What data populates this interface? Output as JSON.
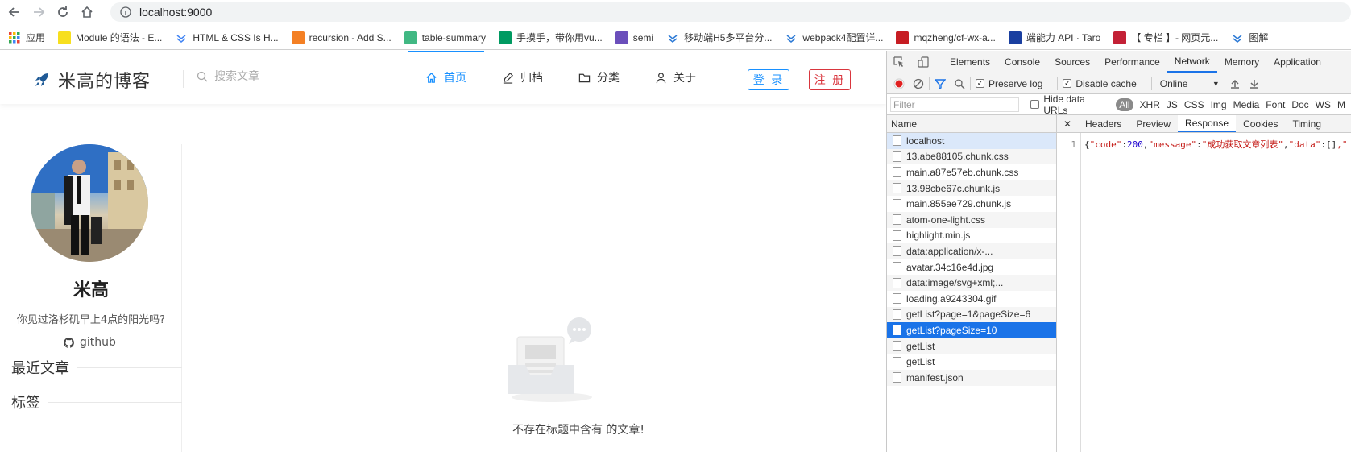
{
  "browser": {
    "url": "localhost:9000",
    "bookmarks": [
      {
        "label": "应用",
        "icon": "apps-grid-icon",
        "color": "#1a73e8"
      },
      {
        "label": "Module 的语法 - E...",
        "icon": "es-icon",
        "color": "#f7df1e"
      },
      {
        "label": "HTML & CSS Is H...",
        "icon": "star-icon",
        "color": "#4285f4"
      },
      {
        "label": "recursion - Add S...",
        "icon": "stackoverflow-icon",
        "color": "#f48024"
      },
      {
        "label": "table-summary",
        "icon": "vue-icon",
        "color": "#41b883"
      },
      {
        "label": "手摸手，带你用vu...",
        "icon": "sf-icon",
        "color": "#009a61"
      },
      {
        "label": "semi",
        "icon": "semi-icon",
        "color": "#6b4fbb"
      },
      {
        "label": "移动端H5多平台分...",
        "icon": "chevrons-icon",
        "color": "#2e7bd6"
      },
      {
        "label": "webpack4配置详...",
        "icon": "chevrons-icon",
        "color": "#2e7bd6"
      },
      {
        "label": "mqzheng/cf-wx-a...",
        "icon": "gitee-icon",
        "color": "#c71d23"
      },
      {
        "label": "端能力 API · Taro",
        "icon": "taro-icon",
        "color": "#1a3fa0"
      },
      {
        "label": "【 专栏 】- 网页元...",
        "icon": "csdn-icon",
        "color": "#c32136"
      },
      {
        "label": "图解",
        "icon": "chevrons-icon",
        "color": "#2e7bd6"
      }
    ]
  },
  "blog": {
    "site_title": "米高的博客",
    "search_placeholder": "搜索文章",
    "nav": [
      {
        "label": "首页",
        "icon": "home-icon",
        "active": true
      },
      {
        "label": "归档",
        "icon": "edit-icon",
        "active": false
      },
      {
        "label": "分类",
        "icon": "folder-icon",
        "active": false
      },
      {
        "label": "关于",
        "icon": "user-icon",
        "active": false
      }
    ],
    "login_label": "登 录",
    "register_label": "注 册",
    "profile": {
      "name": "米高",
      "bio": "你见过洛杉矶早上4点的阳光吗?",
      "github_label": "github"
    },
    "sections": {
      "recent": "最近文章",
      "tags": "标签"
    },
    "empty_text": "不存在标题中含有 的文章!"
  },
  "devtools": {
    "tabs": [
      "Elements",
      "Console",
      "Sources",
      "Performance",
      "Network",
      "Memory",
      "Application"
    ],
    "active_tab": "Network",
    "toolbar": {
      "preserve_log": "Preserve log",
      "disable_cache": "Disable cache",
      "throttling": "Online"
    },
    "filter": {
      "placeholder": "Filter",
      "hide_data_urls": "Hide data URLs",
      "types": [
        "All",
        "XHR",
        "JS",
        "CSS",
        "Img",
        "Media",
        "Font",
        "Doc",
        "WS",
        "M"
      ]
    },
    "name_header": "Name",
    "requests": [
      "localhost",
      "13.abe88105.chunk.css",
      "main.a87e57eb.chunk.css",
      "13.98cbe67c.chunk.js",
      "main.855ae729.chunk.js",
      "atom-one-light.css",
      "highlight.min.js",
      "data:application/x-...",
      "avatar.34c16e4d.jpg",
      "data:image/svg+xml;...",
      "loading.a9243304.gif",
      "getList?page=1&pageSize=6",
      "getList?pageSize=10",
      "getList",
      "getList",
      "manifest.json"
    ],
    "selected_request": "getList?pageSize=10",
    "detail_tabs": [
      "Headers",
      "Preview",
      "Response",
      "Cookies",
      "Timing"
    ],
    "active_detail_tab": "Response",
    "response": {
      "line_number": "1",
      "open": "{",
      "k_code": "\"code\"",
      "colon1": ":",
      "v_code": "200",
      "comma1": ",",
      "k_message": "\"message\"",
      "colon2": ":",
      "v_message": "\"成功获取文章列表\"",
      "comma2": ",",
      "k_data": "\"data\"",
      "colon3": ":",
      "v_data": "[]",
      "tail": ",\""
    }
  }
}
